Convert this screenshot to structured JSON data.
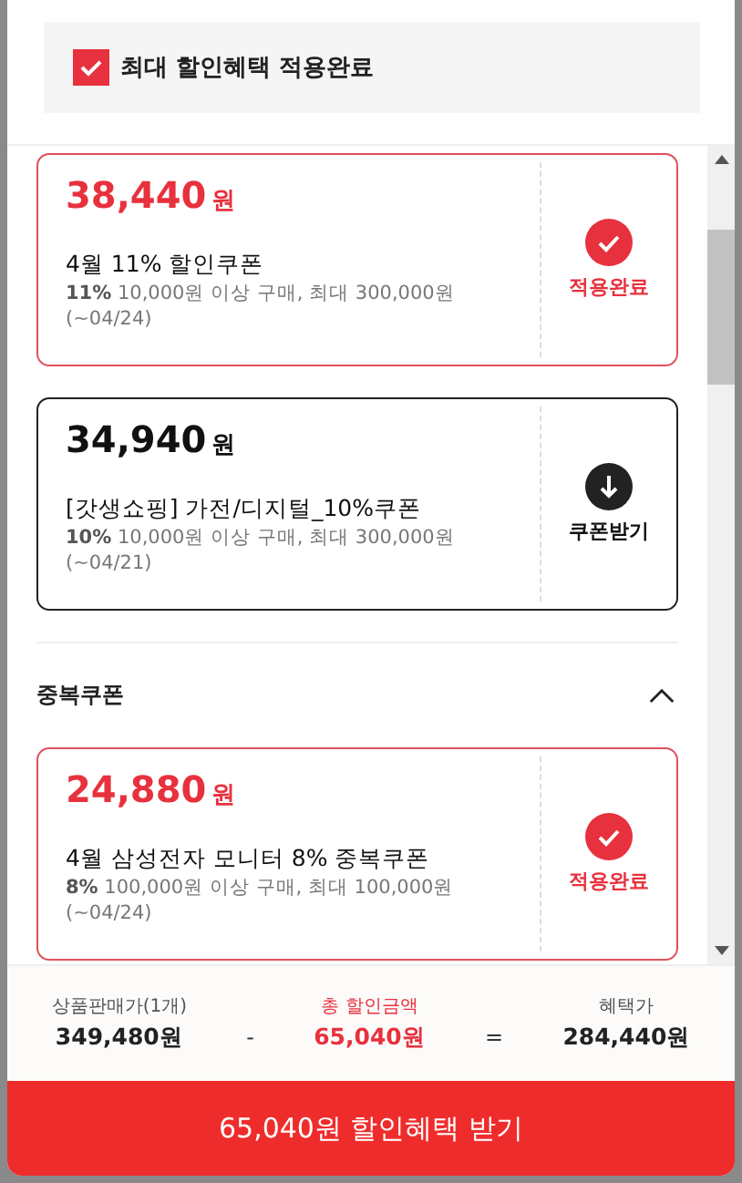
{
  "header": {
    "label": "최대 할인혜택 적용완료",
    "checked": true
  },
  "coupons": [
    {
      "price": "38,440",
      "unit": "원",
      "title": "4월 11% 할인쿠폰",
      "desc": "**11%** 10,000원 이상 구매, 최대 300,000원",
      "period": "(~04/24)",
      "applied": true,
      "action": "적용완료"
    },
    {
      "price": "34,940",
      "unit": "원",
      "title": "[갓생쇼핑] 가전/디지털_10%쿠폰",
      "desc": "**10%** 10,000원 이상 구매, 최대 300,000원",
      "period": "(~04/21)",
      "applied": false,
      "action": "쿠폰받기"
    }
  ],
  "section": {
    "title": "중복쿠폰",
    "expanded": true
  },
  "stack_coupons": [
    {
      "price": "24,880",
      "unit": "원",
      "title": "4월 삼성전자 모니터 8% 중복쿠폰",
      "desc": "**8%** 100,000원 이상 구매, 최대 100,000원",
      "period": "(~04/24)",
      "applied": true,
      "action": "적용완료"
    }
  ],
  "summary": {
    "price_label": "상품판매가(1개)",
    "price": "349,480원",
    "minus": "-",
    "discount_label": "총 할인금액",
    "discount": "65,040원",
    "equals": "=",
    "final_label": "혜택가",
    "final": "284,440원"
  },
  "button": "65,040원 할인혜택 받기"
}
